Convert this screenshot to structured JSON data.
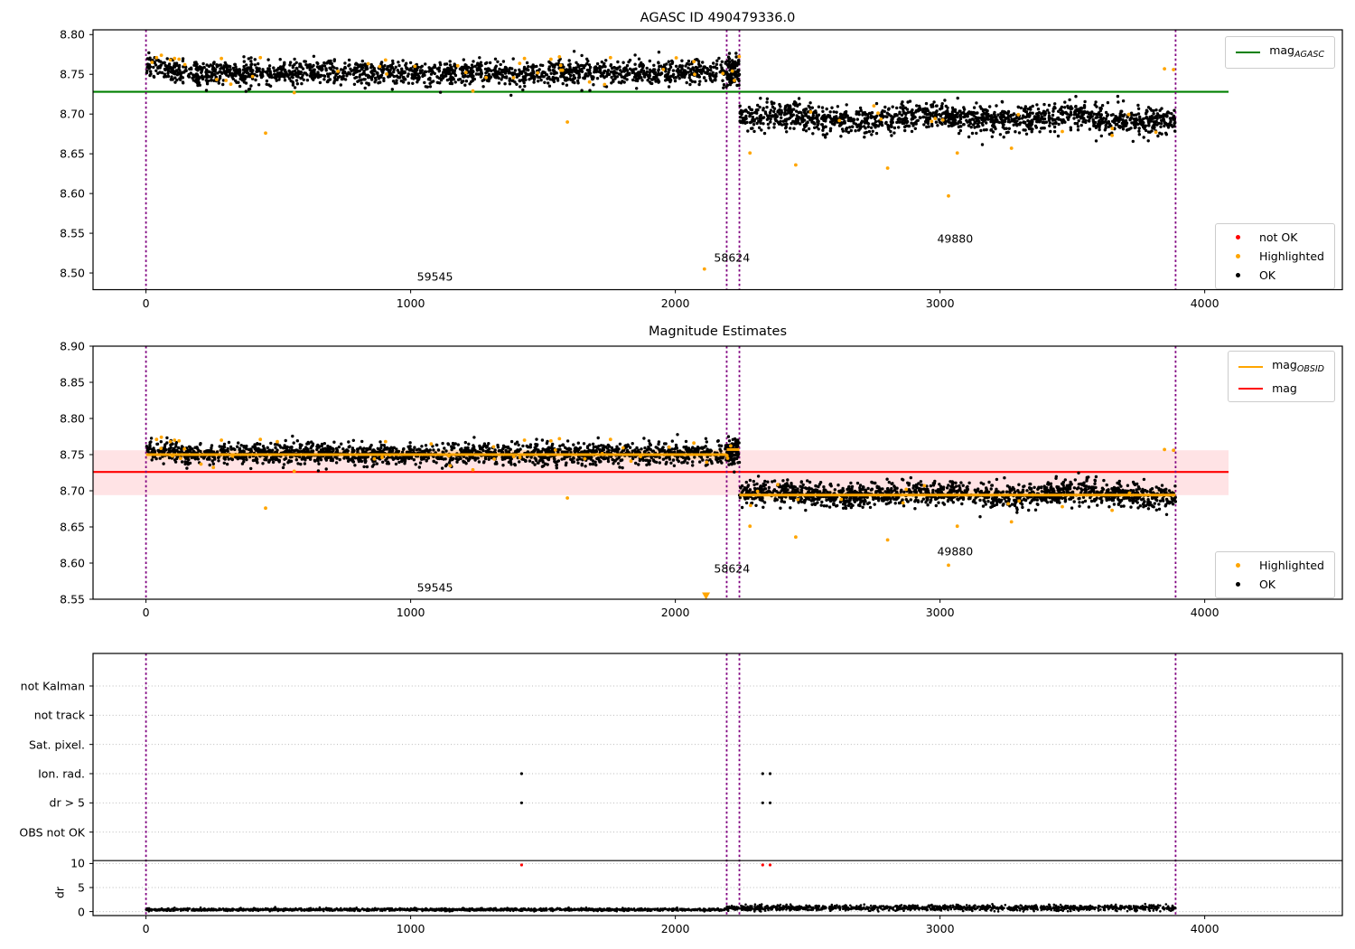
{
  "figure": {
    "background": "#ffffff"
  },
  "colors": {
    "agasc_line": "#008000",
    "obsid_line": "#ffa500",
    "mag_line": "#ff0000",
    "band_pink": "rgba(255,70,80,0.15)",
    "band_wheat": "rgba(255,165,0,0.18)",
    "vline": "#800080",
    "ok": "#000000",
    "highlighted": "#ffa500",
    "not_ok": "#ff0000",
    "grid": "#bbbbbb",
    "spine": "#000000"
  },
  "chart_data": [
    {
      "type": "scatter",
      "title": "AGASC ID 490479336.0",
      "xlim": [
        -200,
        4520
      ],
      "ylim": [
        8.479,
        8.806
      ],
      "xticks": [
        "0",
        "1000",
        "2000",
        "3000",
        "4000"
      ],
      "xtick_values": [
        0,
        1000,
        2000,
        3000,
        4000
      ],
      "yticks": [
        "8.50",
        "8.55",
        "8.60",
        "8.65",
        "8.70",
        "8.75",
        "8.80"
      ],
      "ytick_values": [
        8.5,
        8.55,
        8.6,
        8.65,
        8.7,
        8.75,
        8.8
      ],
      "legend_lines": [
        {
          "label": "mag",
          "subscript": "AGASC",
          "color_key": "agasc_line"
        }
      ],
      "legend_markers": [
        {
          "label": "not OK",
          "color_key": "not_ok"
        },
        {
          "label": "Highlighted",
          "color_key": "highlighted"
        },
        {
          "label": "OK",
          "color_key": "ok"
        }
      ],
      "hline": {
        "y": 8.728,
        "x0": -200,
        "x1": 4090,
        "color_key": "agasc_line"
      },
      "vlines": [
        0,
        2194,
        2242,
        3890
      ],
      "annotations": [
        {
          "text": "59545",
          "x": 1092,
          "y": 8.496
        },
        {
          "text": "58624",
          "x": 2214,
          "y": 8.519
        },
        {
          "text": "49880",
          "x": 3057,
          "y": 8.543
        }
      ],
      "clusters": [
        {
          "x0": 0,
          "x1": 2194,
          "mean": 8.752,
          "sd": 0.0075,
          "n": 1700,
          "n_highlight": 26,
          "start_bump": true,
          "seed": 11
        },
        {
          "x0": 2194,
          "x1": 2242,
          "mean": 8.755,
          "sd": 0.009,
          "n": 90,
          "n_highlight": 3,
          "seed": 12
        },
        {
          "x0": 2242,
          "x1": 3890,
          "mean": 8.695,
          "sd": 0.0085,
          "n": 1400,
          "n_highlight": 12,
          "wave_amp": 0.004,
          "wave_period": 560,
          "seed": 13
        }
      ],
      "highlighted_points": [
        [
          40,
          8.771
        ],
        [
          58,
          8.774
        ],
        [
          92,
          8.768
        ],
        [
          108,
          8.77
        ],
        [
          125,
          8.769
        ],
        [
          285,
          8.77
        ],
        [
          432,
          8.771
        ],
        [
          452,
          8.676
        ],
        [
          560,
          8.727
        ],
        [
          905,
          8.768
        ],
        [
          1235,
          8.729
        ],
        [
          1430,
          8.77
        ],
        [
          1530,
          8.769
        ],
        [
          1562,
          8.772
        ],
        [
          1592,
          8.69
        ],
        [
          1755,
          8.771
        ],
        [
          2070,
          8.766
        ],
        [
          2110,
          8.505
        ],
        [
          2282,
          8.651
        ],
        [
          2455,
          8.636
        ],
        [
          2802,
          8.632
        ],
        [
          3032,
          8.597
        ],
        [
          3065,
          8.651
        ],
        [
          3270,
          8.657
        ],
        [
          3462,
          8.678
        ],
        [
          3650,
          8.673
        ],
        [
          3848,
          8.757
        ],
        [
          3882,
          8.756
        ]
      ]
    },
    {
      "type": "scatter",
      "title": "Magnitude Estimates",
      "xlim": [
        -200,
        4520
      ],
      "ylim": [
        8.55,
        8.9
      ],
      "xticks": [
        "0",
        "1000",
        "2000",
        "3000",
        "4000"
      ],
      "xtick_values": [
        0,
        1000,
        2000,
        3000,
        4000
      ],
      "yticks": [
        "8.55",
        "8.60",
        "8.65",
        "8.70",
        "8.75",
        "8.80",
        "8.85",
        "8.90"
      ],
      "ytick_values": [
        8.55,
        8.6,
        8.65,
        8.7,
        8.75,
        8.8,
        8.85,
        8.9
      ],
      "legend_lines": [
        {
          "label": "mag",
          "subscript": "OBSID",
          "color_key": "obsid_line"
        },
        {
          "label": "mag",
          "subscript": "",
          "color_key": "mag_line"
        }
      ],
      "legend_markers": [
        {
          "label": "Highlighted",
          "color_key": "highlighted"
        },
        {
          "label": "OK",
          "color_key": "ok"
        }
      ],
      "hline": {
        "y": 8.726,
        "x0": -200,
        "x1": 4090,
        "color_key": "mag_line"
      },
      "band": {
        "y0": 8.694,
        "y1": 8.756,
        "x0": -200,
        "x1": 4090,
        "color_key": "band_pink"
      },
      "obsid_segments": [
        {
          "x0": 0,
          "x1": 2194,
          "y": 8.75
        },
        {
          "x0": 2194,
          "x1": 2242,
          "y": 8.757
        },
        {
          "x0": 2242,
          "x1": 3890,
          "y": 8.694
        }
      ],
      "obsid_band_halfwidth": 0.007,
      "vlines": [
        0,
        2194,
        2242,
        3890
      ],
      "annotations": [
        {
          "text": "59545",
          "x": 1092,
          "y": 8.566
        },
        {
          "text": "58624",
          "x": 2214,
          "y": 8.593
        },
        {
          "text": "49880",
          "x": 3057,
          "y": 8.616
        }
      ],
      "clusters": [
        {
          "x0": 0,
          "x1": 2194,
          "mean": 8.751,
          "sd": 0.0075,
          "n": 1700,
          "n_highlight": 26,
          "start_bump": true,
          "seed": 11
        },
        {
          "x0": 2194,
          "x1": 2242,
          "mean": 8.755,
          "sd": 0.009,
          "n": 90,
          "n_highlight": 3,
          "seed": 12
        },
        {
          "x0": 2242,
          "x1": 3890,
          "mean": 8.695,
          "sd": 0.0085,
          "n": 1400,
          "n_highlight": 12,
          "wave_amp": 0.004,
          "wave_period": 560,
          "seed": 13
        }
      ],
      "highlighted_points": [
        [
          40,
          8.771
        ],
        [
          58,
          8.774
        ],
        [
          92,
          8.768
        ],
        [
          108,
          8.77
        ],
        [
          125,
          8.769
        ],
        [
          285,
          8.77
        ],
        [
          432,
          8.771
        ],
        [
          452,
          8.676
        ],
        [
          560,
          8.727
        ],
        [
          905,
          8.768
        ],
        [
          1235,
          8.729
        ],
        [
          1430,
          8.77
        ],
        [
          1530,
          8.769
        ],
        [
          1562,
          8.772
        ],
        [
          1592,
          8.69
        ],
        [
          1755,
          8.771
        ],
        [
          2070,
          8.766
        ],
        [
          2110,
          8.505
        ],
        [
          2282,
          8.651
        ],
        [
          2455,
          8.636
        ],
        [
          2802,
          8.632
        ],
        [
          3032,
          8.597
        ],
        [
          3065,
          8.651
        ],
        [
          3270,
          8.657
        ],
        [
          3462,
          8.678
        ],
        [
          3650,
          8.673
        ],
        [
          3848,
          8.757
        ],
        [
          3882,
          8.756
        ]
      ],
      "clip_markers": [
        {
          "x": 2116,
          "symbol": "triangle-down",
          "color_key": "highlighted"
        }
      ]
    },
    {
      "type": "flags",
      "flag_labels": [
        "not Kalman",
        "not track",
        "Sat. pixel.",
        "Ion. rad.",
        "dr > 5",
        "OBS not OK"
      ],
      "dr_label": "dr",
      "dr_ticks": [
        "10",
        "5",
        "0"
      ],
      "dr_tick_values": [
        10,
        5,
        0
      ],
      "xlim": [
        -200,
        4520
      ],
      "xticks": [
        "0",
        "1000",
        "2000",
        "3000",
        "4000"
      ],
      "xtick_values": [
        0,
        1000,
        2000,
        3000,
        4000
      ],
      "vlines": [
        0,
        2194,
        2242,
        3890
      ],
      "separator_dr": 10.6,
      "flag_points": {
        "Ion. rad.": [
          1419,
          2330,
          2358
        ],
        "dr > 5": [
          1419,
          2330,
          2358
        ]
      },
      "red_dr_points": [
        [
          1419,
          9.7
        ],
        [
          2330,
          9.7
        ],
        [
          2358,
          9.7
        ]
      ],
      "dr_trace": [
        {
          "x0": 0,
          "x1": 2194,
          "mean": 0.42,
          "sd": 0.13,
          "n": 1500,
          "seed": 21
        },
        {
          "x0": 2194,
          "x1": 2242,
          "mean": 0.8,
          "sd": 0.2,
          "n": 40,
          "seed": 22
        },
        {
          "x0": 2242,
          "x1": 3890,
          "mean": 0.75,
          "sd": 0.28,
          "n": 1150,
          "seed": 23
        }
      ]
    }
  ]
}
